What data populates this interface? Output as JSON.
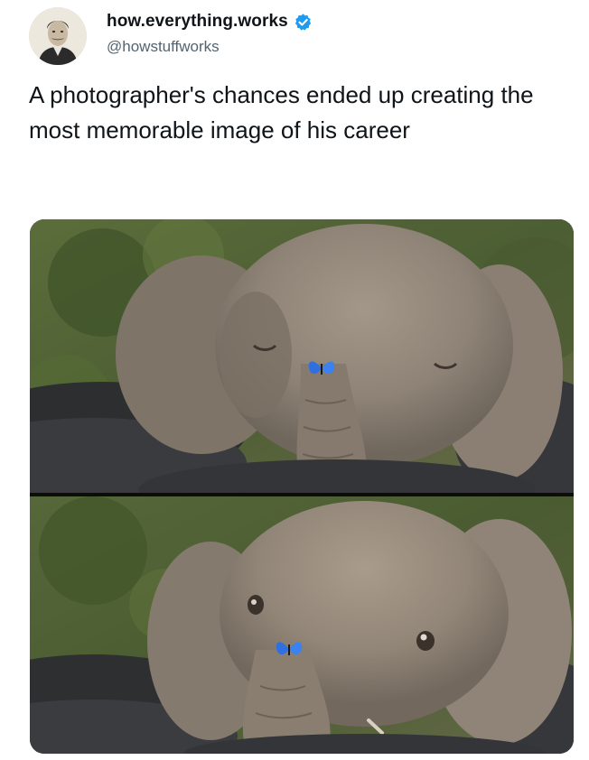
{
  "post": {
    "author": {
      "display_name": "how.everything.works",
      "handle": "@howstuffworks",
      "verified": true,
      "verified_icon": "verified-badge-icon",
      "verified_color": "#1d9bf0"
    },
    "text": "A photographer's chances ended up creating the most memorable image of his career"
  },
  "media": {
    "photos": [
      {
        "subject": "elephant-calf-eyes-closed-butterfly-on-trunk"
      },
      {
        "subject": "elephant-calf-eyes-open-butterfly-on-trunk"
      }
    ]
  },
  "colors": {
    "text": "#0f1419",
    "secondary_text": "#536471",
    "accent": "#1d9bf0",
    "butterfly": "#2f6fe0"
  }
}
